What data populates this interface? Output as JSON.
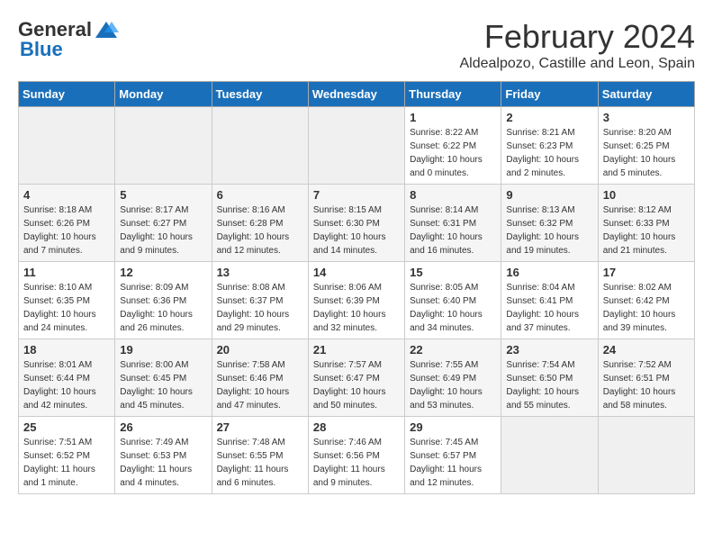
{
  "header": {
    "logo_general": "General",
    "logo_blue": "Blue",
    "month_title": "February 2024",
    "location": "Aldealpozo, Castille and Leon, Spain"
  },
  "weekdays": [
    "Sunday",
    "Monday",
    "Tuesday",
    "Wednesday",
    "Thursday",
    "Friday",
    "Saturday"
  ],
  "weeks": [
    [
      {
        "day": "",
        "empty": true
      },
      {
        "day": "",
        "empty": true
      },
      {
        "day": "",
        "empty": true
      },
      {
        "day": "",
        "empty": true
      },
      {
        "day": "1",
        "sunrise": "8:22 AM",
        "sunset": "6:22 PM",
        "daylight": "10 hours and 0 minutes."
      },
      {
        "day": "2",
        "sunrise": "8:21 AM",
        "sunset": "6:23 PM",
        "daylight": "10 hours and 2 minutes."
      },
      {
        "day": "3",
        "sunrise": "8:20 AM",
        "sunset": "6:25 PM",
        "daylight": "10 hours and 5 minutes."
      }
    ],
    [
      {
        "day": "4",
        "sunrise": "8:18 AM",
        "sunset": "6:26 PM",
        "daylight": "10 hours and 7 minutes."
      },
      {
        "day": "5",
        "sunrise": "8:17 AM",
        "sunset": "6:27 PM",
        "daylight": "10 hours and 9 minutes."
      },
      {
        "day": "6",
        "sunrise": "8:16 AM",
        "sunset": "6:28 PM",
        "daylight": "10 hours and 12 minutes."
      },
      {
        "day": "7",
        "sunrise": "8:15 AM",
        "sunset": "6:30 PM",
        "daylight": "10 hours and 14 minutes."
      },
      {
        "day": "8",
        "sunrise": "8:14 AM",
        "sunset": "6:31 PM",
        "daylight": "10 hours and 16 minutes."
      },
      {
        "day": "9",
        "sunrise": "8:13 AM",
        "sunset": "6:32 PM",
        "daylight": "10 hours and 19 minutes."
      },
      {
        "day": "10",
        "sunrise": "8:12 AM",
        "sunset": "6:33 PM",
        "daylight": "10 hours and 21 minutes."
      }
    ],
    [
      {
        "day": "11",
        "sunrise": "8:10 AM",
        "sunset": "6:35 PM",
        "daylight": "10 hours and 24 minutes."
      },
      {
        "day": "12",
        "sunrise": "8:09 AM",
        "sunset": "6:36 PM",
        "daylight": "10 hours and 26 minutes."
      },
      {
        "day": "13",
        "sunrise": "8:08 AM",
        "sunset": "6:37 PM",
        "daylight": "10 hours and 29 minutes."
      },
      {
        "day": "14",
        "sunrise": "8:06 AM",
        "sunset": "6:39 PM",
        "daylight": "10 hours and 32 minutes."
      },
      {
        "day": "15",
        "sunrise": "8:05 AM",
        "sunset": "6:40 PM",
        "daylight": "10 hours and 34 minutes."
      },
      {
        "day": "16",
        "sunrise": "8:04 AM",
        "sunset": "6:41 PM",
        "daylight": "10 hours and 37 minutes."
      },
      {
        "day": "17",
        "sunrise": "8:02 AM",
        "sunset": "6:42 PM",
        "daylight": "10 hours and 39 minutes."
      }
    ],
    [
      {
        "day": "18",
        "sunrise": "8:01 AM",
        "sunset": "6:44 PM",
        "daylight": "10 hours and 42 minutes."
      },
      {
        "day": "19",
        "sunrise": "8:00 AM",
        "sunset": "6:45 PM",
        "daylight": "10 hours and 45 minutes."
      },
      {
        "day": "20",
        "sunrise": "7:58 AM",
        "sunset": "6:46 PM",
        "daylight": "10 hours and 47 minutes."
      },
      {
        "day": "21",
        "sunrise": "7:57 AM",
        "sunset": "6:47 PM",
        "daylight": "10 hours and 50 minutes."
      },
      {
        "day": "22",
        "sunrise": "7:55 AM",
        "sunset": "6:49 PM",
        "daylight": "10 hours and 53 minutes."
      },
      {
        "day": "23",
        "sunrise": "7:54 AM",
        "sunset": "6:50 PM",
        "daylight": "10 hours and 55 minutes."
      },
      {
        "day": "24",
        "sunrise": "7:52 AM",
        "sunset": "6:51 PM",
        "daylight": "10 hours and 58 minutes."
      }
    ],
    [
      {
        "day": "25",
        "sunrise": "7:51 AM",
        "sunset": "6:52 PM",
        "daylight": "11 hours and 1 minute."
      },
      {
        "day": "26",
        "sunrise": "7:49 AM",
        "sunset": "6:53 PM",
        "daylight": "11 hours and 4 minutes."
      },
      {
        "day": "27",
        "sunrise": "7:48 AM",
        "sunset": "6:55 PM",
        "daylight": "11 hours and 6 minutes."
      },
      {
        "day": "28",
        "sunrise": "7:46 AM",
        "sunset": "6:56 PM",
        "daylight": "11 hours and 9 minutes."
      },
      {
        "day": "29",
        "sunrise": "7:45 AM",
        "sunset": "6:57 PM",
        "daylight": "11 hours and 12 minutes."
      },
      {
        "day": "",
        "empty": true
      },
      {
        "day": "",
        "empty": true
      }
    ]
  ],
  "labels": {
    "sunrise": "Sunrise:",
    "sunset": "Sunset:",
    "daylight": "Daylight:"
  }
}
